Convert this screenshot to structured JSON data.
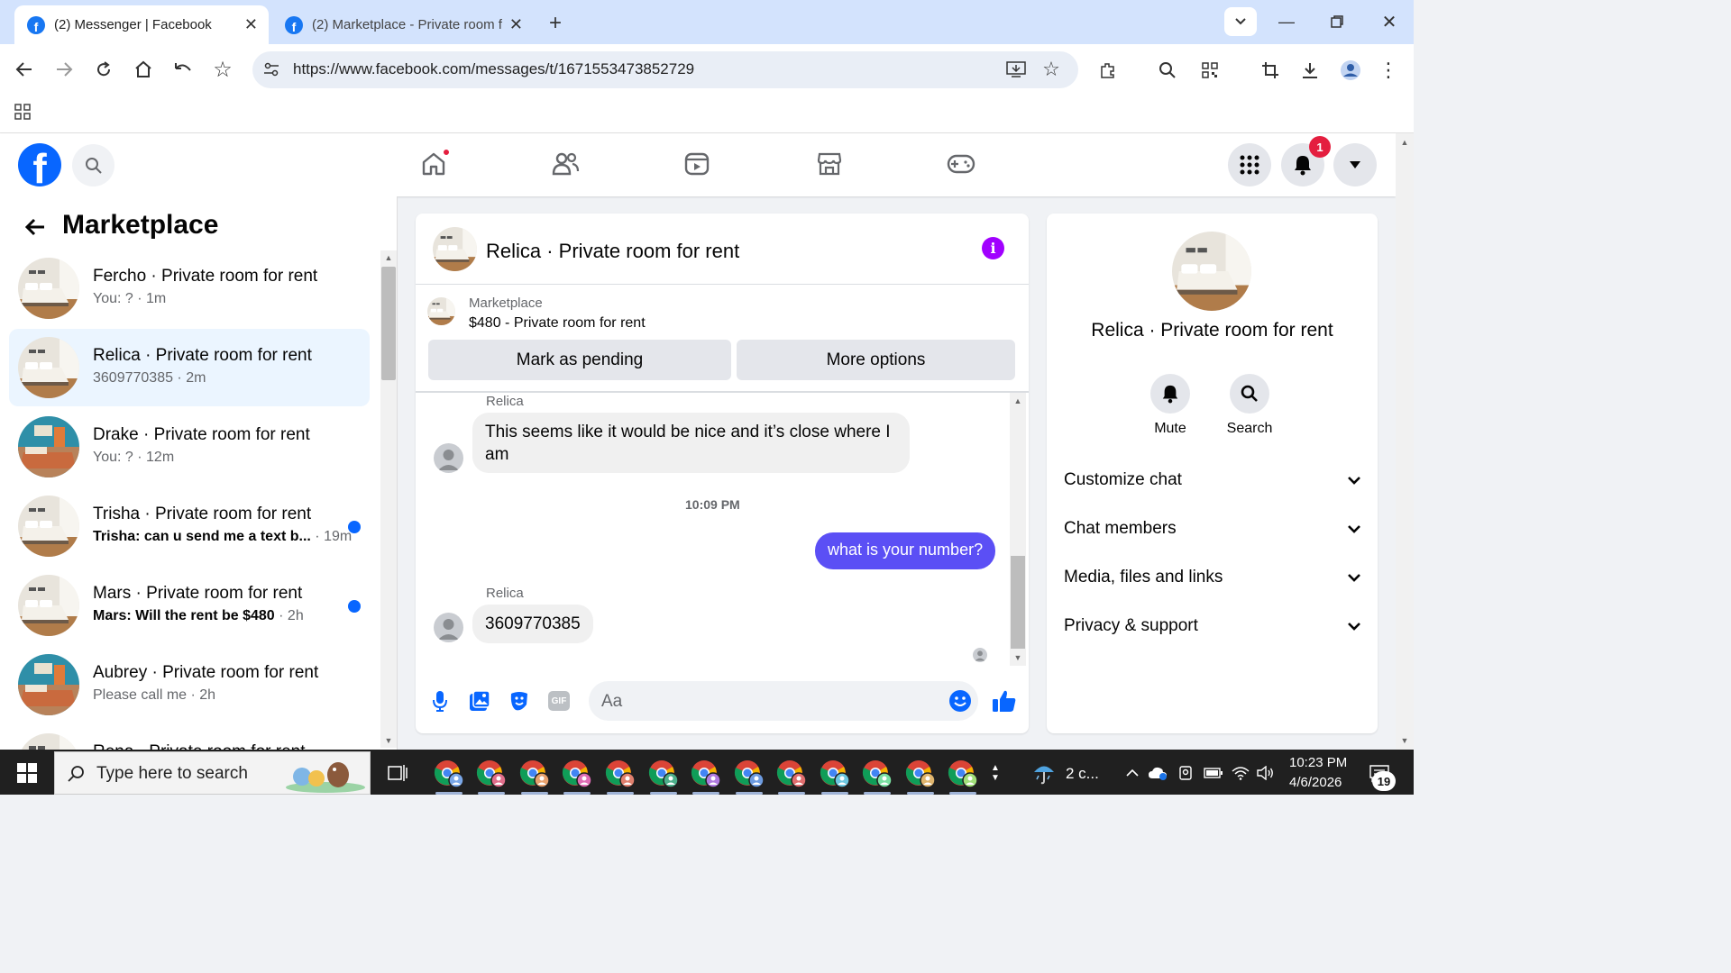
{
  "browser": {
    "tabs": [
      {
        "title": "(2) Messenger | Facebook",
        "active": true
      },
      {
        "title": "(2) Marketplace - Private room f",
        "active": false
      }
    ],
    "url": "https://www.facebook.com/messages/t/1671553473852729"
  },
  "header": {
    "notification_count": "1"
  },
  "sidebar": {
    "title": "Marketplace",
    "conversations": [
      {
        "name": "Fercho · Private room for rent",
        "preview": "You: ?",
        "ago": "1m",
        "unread": false,
        "selected": false
      },
      {
        "name": "Relica · Private room for rent",
        "preview": "3609770385",
        "ago": "2m",
        "unread": false,
        "selected": true
      },
      {
        "name": "Drake · Private room for rent",
        "preview": "You: ?",
        "ago": "12m",
        "unread": false,
        "selected": false
      },
      {
        "name": "Trisha · Private room for rent",
        "preview": "Trisha: can u send me a text b...",
        "ago": "19m",
        "unread": true,
        "selected": false
      },
      {
        "name": "Mars · Private room for rent",
        "preview": "Mars: Will the rent be $480",
        "ago": "2h",
        "unread": true,
        "selected": false
      },
      {
        "name": "Aubrey · Private room for rent",
        "preview": "Please call me",
        "ago": "2h",
        "unread": false,
        "selected": false
      },
      {
        "name": "Rena · Private room for rent",
        "preview": "",
        "ago": "",
        "unread": false,
        "selected": false
      }
    ]
  },
  "chat": {
    "title": "Relica · Private room for rent",
    "marketplace_label": "Marketplace",
    "listing": "$480 - Private room for rent",
    "mark_pending_label": "Mark as pending",
    "more_options_label": "More options",
    "messages": [
      {
        "sender": "Relica",
        "text": "This seems like it would be nice and it’s close where I am",
        "direction": "in"
      },
      {
        "timestamp": "10:09 PM"
      },
      {
        "text": "what is your number?",
        "direction": "out"
      },
      {
        "sender": "Relica",
        "text": "3609770385",
        "direction": "in"
      }
    ],
    "composer_placeholder": "Aa"
  },
  "info_panel": {
    "title": "Relica · Private room for rent",
    "actions": [
      {
        "label": "Mute",
        "icon": "bell-icon"
      },
      {
        "label": "Search",
        "icon": "search-icon"
      }
    ],
    "sections": [
      "Customize chat",
      "Chat members",
      "Media, files and links",
      "Privacy & support"
    ]
  },
  "taskbar": {
    "search_placeholder": "Type here to search",
    "weather": "2 c...",
    "time": "10:23 PM",
    "date": "4/6/2026",
    "notification_count": "19"
  },
  "colors": {
    "fb_blue": "#0866ff",
    "outgoing_bubble": "#5b4ff5",
    "info_icon": "#a100ff",
    "badge_red": "#e41e3f"
  }
}
